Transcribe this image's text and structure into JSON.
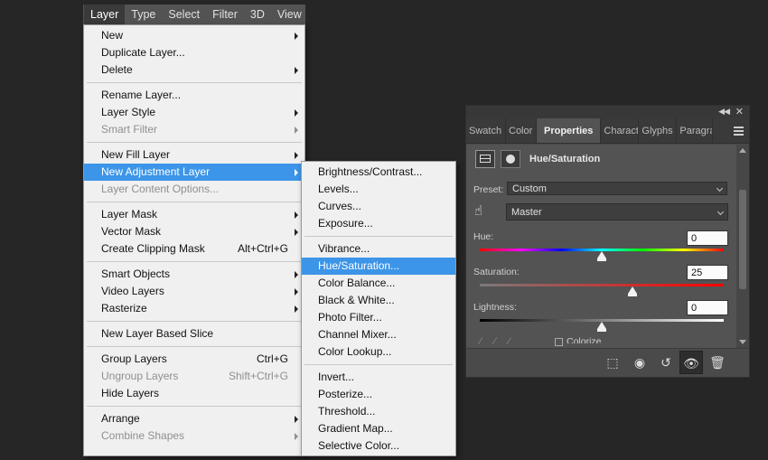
{
  "menubar": {
    "items": [
      "Layer",
      "Type",
      "Select",
      "Filter",
      "3D",
      "View"
    ]
  },
  "layer_menu": {
    "items": [
      {
        "label": "New",
        "submenu": true
      },
      {
        "label": "Duplicate Layer..."
      },
      {
        "label": "Delete",
        "submenu": true
      },
      {
        "sep": true
      },
      {
        "label": "Rename Layer..."
      },
      {
        "label": "Layer Style",
        "submenu": true
      },
      {
        "label": "Smart Filter",
        "submenu": true,
        "disabled": true
      },
      {
        "sep": true
      },
      {
        "label": "New Fill Layer",
        "submenu": true
      },
      {
        "label": "New Adjustment Layer",
        "submenu": true,
        "highlighted": true
      },
      {
        "label": "Layer Content Options...",
        "disabled": true
      },
      {
        "sep": true
      },
      {
        "label": "Layer Mask",
        "submenu": true
      },
      {
        "label": "Vector Mask",
        "submenu": true
      },
      {
        "label": "Create Clipping Mask",
        "shortcut": "Alt+Ctrl+G"
      },
      {
        "sep": true
      },
      {
        "label": "Smart Objects",
        "submenu": true
      },
      {
        "label": "Video Layers",
        "submenu": true
      },
      {
        "label": "Rasterize",
        "submenu": true
      },
      {
        "sep": true
      },
      {
        "label": "New Layer Based Slice"
      },
      {
        "sep": true
      },
      {
        "label": "Group Layers",
        "shortcut": "Ctrl+G"
      },
      {
        "label": "Ungroup Layers",
        "shortcut": "Shift+Ctrl+G",
        "disabled": true
      },
      {
        "label": "Hide Layers"
      },
      {
        "sep": true
      },
      {
        "label": "Arrange",
        "submenu": true
      },
      {
        "label": "Combine Shapes",
        "submenu": true,
        "disabled": true
      }
    ]
  },
  "adjust_menu": {
    "items": [
      {
        "label": "Brightness/Contrast..."
      },
      {
        "label": "Levels..."
      },
      {
        "label": "Curves..."
      },
      {
        "label": "Exposure..."
      },
      {
        "sep": true
      },
      {
        "label": "Vibrance..."
      },
      {
        "label": "Hue/Saturation...",
        "highlighted": true
      },
      {
        "label": "Color Balance..."
      },
      {
        "label": "Black & White..."
      },
      {
        "label": "Photo Filter..."
      },
      {
        "label": "Channel Mixer..."
      },
      {
        "label": "Color Lookup..."
      },
      {
        "sep": true
      },
      {
        "label": "Invert..."
      },
      {
        "label": "Posterize..."
      },
      {
        "label": "Threshold..."
      },
      {
        "label": "Gradient Map..."
      },
      {
        "label": "Selective Color..."
      }
    ]
  },
  "properties": {
    "tabs": [
      "Swatch",
      "Color",
      "Properties",
      "Characte",
      "Glyphs",
      "Paragra"
    ],
    "active_tab": "Properties",
    "title": "Hue/Saturation",
    "preset_label": "Preset:",
    "preset_value": "Custom",
    "channel_value": "Master",
    "hue_label": "Hue:",
    "hue_value": "0",
    "saturation_label": "Saturation:",
    "saturation_value": "25",
    "lightness_label": "Lightness:",
    "lightness_value": "0",
    "colorize_label": "Colorize",
    "hue_fraction": 0.5,
    "saturation_fraction": 0.625,
    "lightness_fraction": 0.5
  },
  "colors": {
    "menu_highlight": "#3c95e8",
    "app_background": "#262626",
    "panel_background": "#535353"
  }
}
